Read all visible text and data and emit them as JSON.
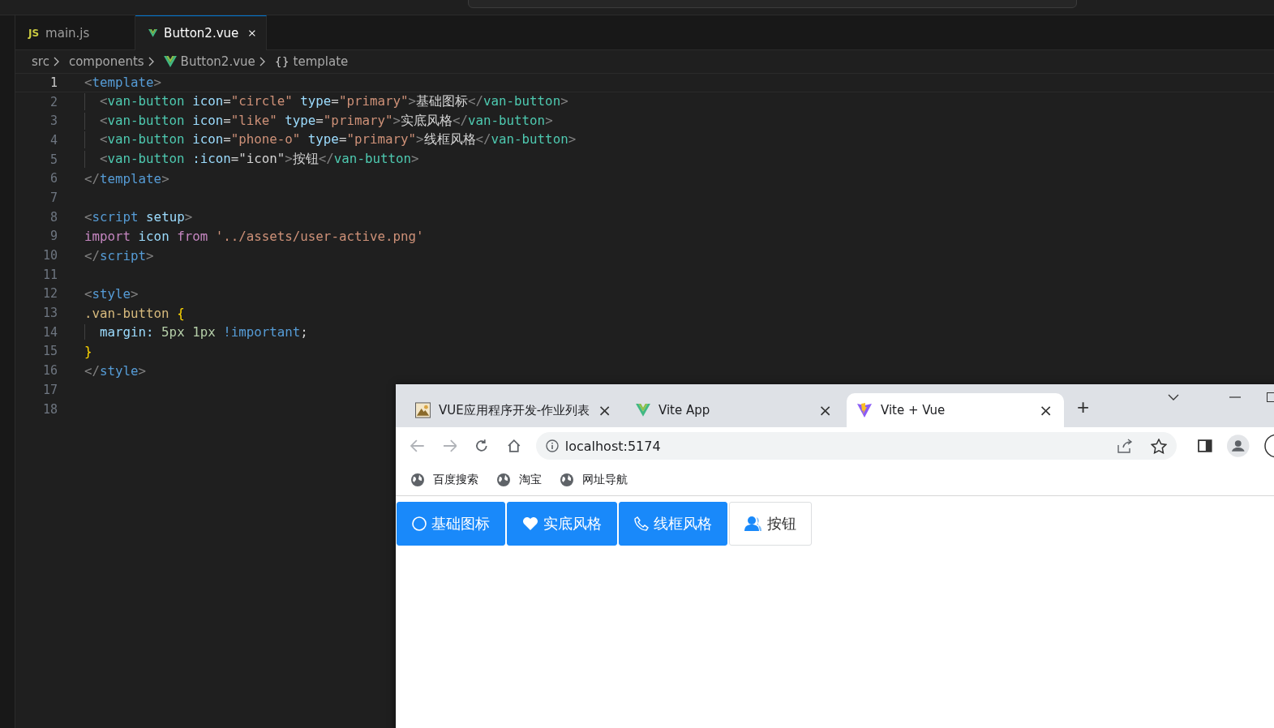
{
  "editor": {
    "tabs": [
      {
        "label": "main.js",
        "kind": "js",
        "badge": "JS",
        "selected": false
      },
      {
        "label": "Button2.vue",
        "kind": "vue",
        "selected": true
      }
    ],
    "breadcrumb": [
      {
        "kind": "folder",
        "label": "src"
      },
      {
        "kind": "folder",
        "label": "components"
      },
      {
        "kind": "vue",
        "label": "Button2.vue"
      },
      {
        "kind": "symbol",
        "glyph": "{}",
        "label": "template"
      }
    ],
    "lines": [
      {
        "number": "1",
        "active": true,
        "text": "<template>",
        "children": [
          {
            "number": "2",
            "active": false,
            "text": "<van-button icon=\"circle\" type=\"primary\">基础图标</van-button>"
          },
          {
            "number": "3",
            "active": false,
            "text": "<van-button icon=\"like\" type=\"primary\">实底风格</van-button>"
          },
          {
            "number": "4",
            "active": false,
            "text": "<van-button icon=\"phone-o\" type=\"primary\">线框风格</van-button>"
          },
          {
            "number": "5",
            "active": false,
            "text": "<van-button :icon=\"icon\">按钮</van-button>"
          }
        ]
      },
      {
        "number": "6",
        "active": false,
        "text": "</template>"
      },
      {
        "number": "7",
        "active": false
      },
      {
        "number": "8",
        "active": false,
        "text": "<script setup>"
      },
      {
        "number": "9",
        "active": false,
        "text": "import icon from '../assets/user-active.png'"
      },
      {
        "number": "10",
        "active": false,
        "text": "</script>"
      },
      {
        "number": "11",
        "active": false
      },
      {
        "number": "12",
        "active": false,
        "text": "<style>"
      },
      {
        "number": "13",
        "active": false,
        "text": ".van-button {",
        "children": [
          {
            "number": "14",
            "active": false,
            "text": "margin: 5px 1px !important;"
          }
        ]
      },
      {
        "number": "15",
        "active": false,
        "text": "}"
      },
      {
        "number": "16",
        "active": false,
        "text": "</style>"
      },
      {
        "number": "17",
        "active": false
      },
      {
        "number": "18",
        "active": false
      }
    ]
  },
  "browser": {
    "tabs": [
      {
        "label": "VUE应用程序开发-作业列表",
        "kind": "picture",
        "selected": false,
        "close": "×"
      },
      {
        "label": "Vite App",
        "kind": "vue",
        "selected": false,
        "close": "×"
      },
      {
        "label": "Vite + Vue",
        "kind": "vite",
        "selected": true,
        "close": "×"
      }
    ],
    "new_tab": "+",
    "address": "localhost:5174",
    "bookmarks": [
      "百度搜索",
      "淘宝",
      "网址导航"
    ],
    "buttons": [
      {
        "label": "基础图标",
        "kind": "circle",
        "primary": true
      },
      {
        "label": "实底风格",
        "kind": "heart",
        "primary": true
      },
      {
        "label": "线框风格",
        "kind": "phone",
        "primary": true
      },
      {
        "label": "按钮",
        "kind": "user",
        "primary": false
      }
    ]
  }
}
